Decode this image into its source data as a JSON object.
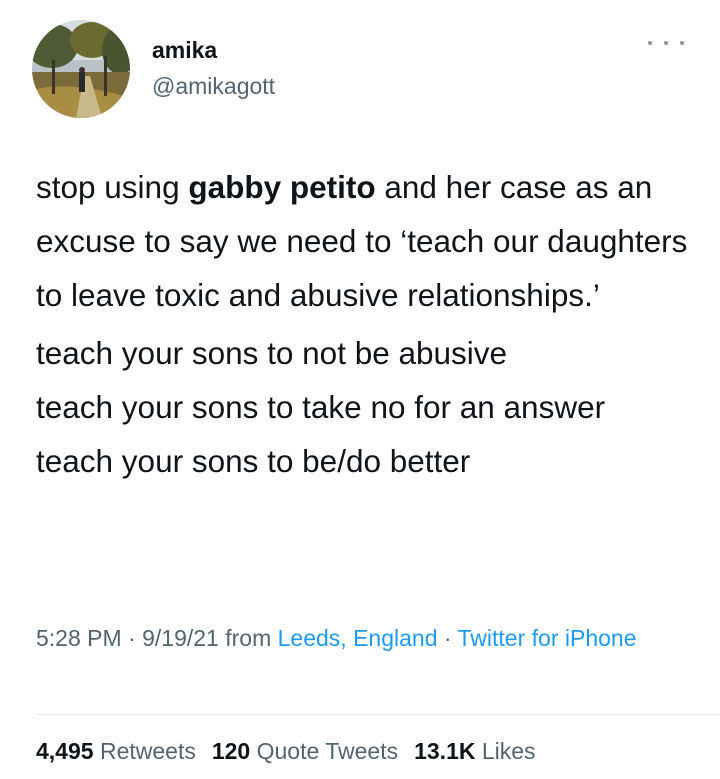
{
  "author": {
    "name": "amika",
    "handle": "@amikagott"
  },
  "icons": {
    "more": "more-horizontal-icon",
    "avatar": "avatar-photo"
  },
  "tweet": {
    "para1": {
      "part1": "stop using ",
      "bold": "gabby petito",
      "part2": " and her case as an excuse to say we need to ‘teach our daughters to leave toxic and abusive relationships.’"
    },
    "lines": [
      "teach your sons to not be abusive",
      "teach your sons to take no for an answer",
      "teach your sons to be/do better"
    ]
  },
  "meta": {
    "time": "5:28 PM",
    "sep1": " · ",
    "date": "9/19/21",
    "from": " from ",
    "location": "Leeds, England",
    "sep2": " · ",
    "source": "Twitter for iPhone"
  },
  "stats": {
    "retweets_count": "4,495",
    "retweets_label": "Retweets",
    "quotes_count": "120",
    "quotes_label": "Quote Tweets",
    "likes_count": "13.1K",
    "likes_label": "Likes"
  },
  "colors": {
    "text": "#0f1419",
    "secondary": "#536471",
    "link": "#1d9bf0",
    "divider": "#e6ecf0"
  }
}
